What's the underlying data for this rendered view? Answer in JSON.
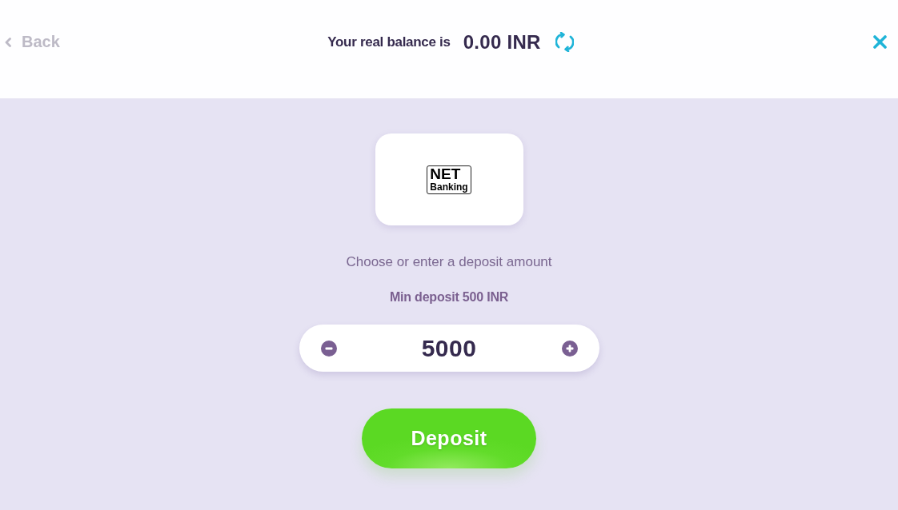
{
  "header": {
    "back_label": "Back",
    "balance_label": "Your real balance is",
    "balance_amount": "0.00 INR"
  },
  "payment_method": {
    "logo_lines": [
      "NET",
      "Banking"
    ]
  },
  "prompt": "Choose or enter a deposit amount",
  "min_deposit": "Min deposit 500 INR",
  "amount_field": {
    "value": "5000"
  },
  "deposit_button": {
    "label": "Deposit"
  }
}
